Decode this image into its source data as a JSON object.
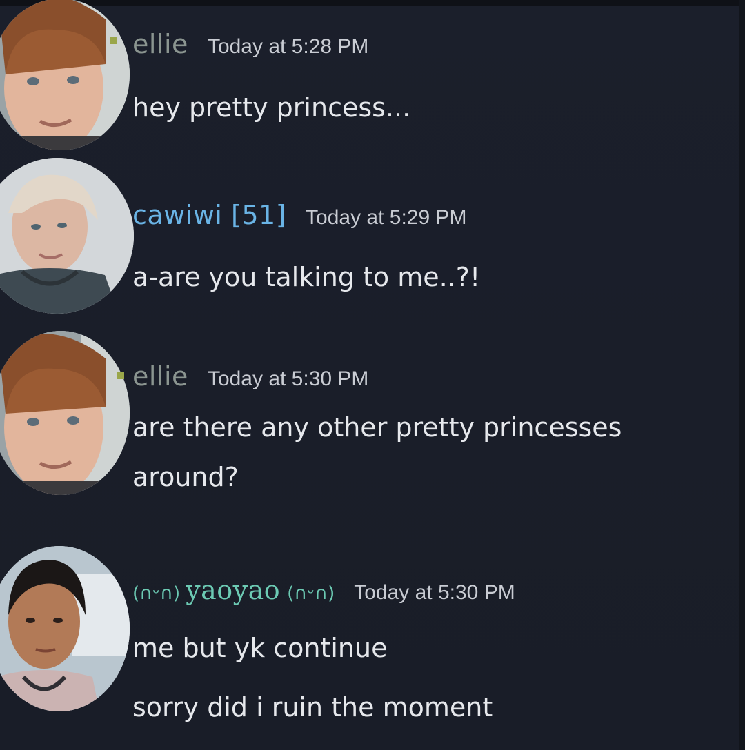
{
  "messages": [
    {
      "username": "ellie",
      "username_color": "#8b9590",
      "timestamp": "Today at 5:28 PM",
      "lines": [
        "hey pretty princess..."
      ]
    },
    {
      "username": "cawiwi [51]",
      "username_color": "#6ab4e6",
      "timestamp": "Today at 5:29 PM",
      "lines": [
        "a-are you talking to me..?!"
      ]
    },
    {
      "username": "ellie",
      "username_color": "#8b9590",
      "timestamp": "Today at 5:30 PM",
      "lines": [
        "are there any other pretty princesses",
        "around?"
      ]
    },
    {
      "username": "yaoyao",
      "username_prefix": "(∩ᵕ∩)",
      "username_suffix": "(∩ᵕ∩)",
      "username_color": "#6ccab3",
      "timestamp": "Today at 5:30 PM",
      "lines": [
        "me but yk continue",
        "sorry did i ruin the moment"
      ]
    }
  ],
  "colors": {
    "background": "#1b1f2a",
    "text": "#e6e8ec",
    "timestamp": "#c9ccd3"
  }
}
